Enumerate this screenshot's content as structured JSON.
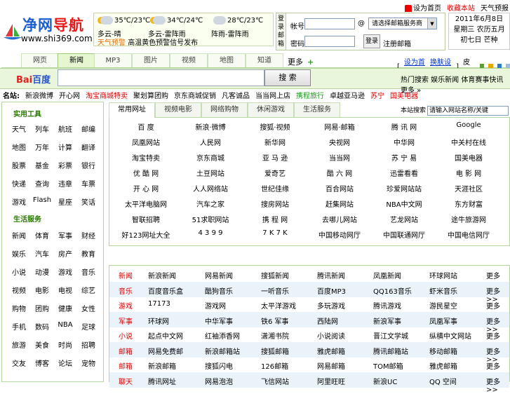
{
  "toplinks": [
    "设为首页",
    "收藏本站",
    "天气预报"
  ],
  "logo": {
    "brand_a": "净网",
    "brand_b": "导航",
    "url": "www.shi369.com"
  },
  "weather": {
    "days": [
      {
        "temp": "35℃/23℃",
        "cond": "多云-晴"
      },
      {
        "temp": "34℃/24℃",
        "cond": "多云-雷阵雨"
      },
      {
        "temp": "28℃/23℃",
        "cond": "阵雨-雷阵雨"
      }
    ],
    "alert_label": "天气预警",
    "alert_text": "高温黄色预警信号发布"
  },
  "mail": {
    "side_label": [
      "登",
      "录",
      "邮",
      "箱"
    ],
    "user_label": "帐号:",
    "pass_label": "密码:",
    "at": "@",
    "select_value": "请选择邮箱服务商",
    "login_button": "登录",
    "register": "注册邮箱"
  },
  "date": {
    "line1": "2011年6月8日",
    "line2": "星期三 农历五月",
    "line3": "初七日 芒种"
  },
  "navtabs": [
    "网页",
    "新闻",
    "MP3",
    "图片",
    "视频",
    "地图",
    "知道"
  ],
  "more_label": "更多",
  "more_plus": "+",
  "colorbar": {
    "link1": "设为首页",
    "link2": "换肤设置",
    "label": "皮肤:",
    "colors": [
      "#5aa02c",
      "#e6a800",
      "#2a7bd0",
      "#9bbde0"
    ]
  },
  "search": {
    "baidu_a": "Bai",
    "baidu_b": "百度",
    "button": "搜 索",
    "hot": "热门搜索 娱乐新闻 体育赛事快讯 更多 »"
  },
  "linkrow": {
    "label": "名站:",
    "items": [
      {
        "t": "新浪微博",
        "c": ""
      },
      {
        "t": "开心网",
        "c": ""
      },
      {
        "t": "淘宝商城特卖",
        "c": "r"
      },
      {
        "t": "聚划算团购",
        "c": ""
      },
      {
        "t": "京东商城促销",
        "c": ""
      },
      {
        "t": "凡客诚品",
        "c": ""
      },
      {
        "t": "当当网上店",
        "c": ""
      },
      {
        "t": "携程旅行",
        "c": "g"
      },
      {
        "t": "卓越亚马逊",
        "c": ""
      },
      {
        "t": "苏宁",
        "c": "r"
      },
      {
        "t": "国美电器",
        "c": "r"
      }
    ]
  },
  "left": {
    "sec1": "实用工具",
    "grid1": [
      [
        "天气",
        "列车",
        "航班",
        "邮编"
      ],
      [
        "地图",
        "万年",
        "计算",
        "翻译"
      ],
      [
        "股票",
        "基金",
        "彩票",
        "银行"
      ],
      [
        "快递",
        "查询",
        "违章",
        "车票"
      ],
      [
        "游戏",
        "Flash",
        "星座",
        "笑话"
      ]
    ],
    "sec2": "生活服务",
    "grid2": [
      [
        "新闻",
        "体育",
        "军事",
        "财经"
      ],
      [
        "娱乐",
        "汽车",
        "房产",
        "教育"
      ],
      [
        "小说",
        "动漫",
        "游戏",
        "音乐"
      ],
      [
        "视频",
        "电影",
        "电视",
        "综艺"
      ],
      [
        "购物",
        "团购",
        "健康",
        "女性"
      ],
      [
        "手机",
        "数码",
        "NBA",
        "足球"
      ],
      [
        "旅游",
        "美食",
        "时尚",
        "招聘"
      ],
      [
        "交友",
        "博客",
        "论坛",
        "宠物"
      ]
    ]
  },
  "cattabs": [
    "常用网址",
    "视频电影",
    "网络购物",
    "休闲游戏",
    "生活服务"
  ],
  "catsearch": {
    "label": "本站搜索",
    "value": "请输入网站名称/关键"
  },
  "sites": [
    [
      "百 度",
      "新浪·微博",
      "搜狐·视频",
      "网易·邮箱",
      "腾 讯 网",
      "Google"
    ],
    [
      "凤凰网站",
      "人民网",
      "新华网",
      "央视网",
      "中华网",
      "中关村在线"
    ],
    [
      "淘宝特卖",
      "京东商城",
      "亚 马 逊",
      "当当网",
      "苏 宁 易",
      "国美电器"
    ],
    [
      "优 酷 网",
      "土豆网站",
      "爱奇艺",
      "酷 六 网",
      "迅雷看看",
      "电 影 网"
    ],
    [
      "开 心 网",
      "人人网络站",
      "世纪佳缘",
      "百合网站",
      "珍爱网站站",
      "天涯社区"
    ],
    [
      "太平洋电脑网",
      "汽车之家",
      "搜房网站",
      "赶集网站",
      "NBA中文网",
      "东方财富"
    ],
    [
      "智联招聘",
      "51求职网站",
      "携 程 网",
      "去哪儿网站",
      "艺龙网站",
      "途牛旅游网"
    ],
    [
      "好123网址大全",
      "4 3 9 9",
      "7 K 7 K",
      "中国移动网厅",
      "中国联通网厅",
      "中国电信网厅"
    ]
  ],
  "rows": [
    {
      "cat": "新闻",
      "items": [
        "新浪新闻",
        "网易新闻",
        "搜狐新闻",
        "腾讯新闻",
        "凤凰新闻",
        "环球网站"
      ],
      "more": "更多>>"
    },
    {
      "cat": "音乐",
      "items": [
        "百度音乐盒",
        "酷狗音乐",
        "一听音乐",
        "百度MP3",
        "QQ163音乐",
        "虾米音乐"
      ],
      "more": "更多>>"
    },
    {
      "cat": "游戏",
      "items": [
        "17173",
        "游戏网",
        "太平洋游戏",
        "多玩游戏",
        "腾讯游戏",
        "游民星空"
      ],
      "more": "更多>>"
    },
    {
      "cat": "军事",
      "items": [
        "环球网",
        "中华军事",
        "铁6 军事",
        "西陆网",
        "新浪军事",
        "凤凰军事"
      ],
      "more": "更多>>"
    },
    {
      "cat": "小说",
      "items": [
        "起点中文网",
        "红袖添香网",
        "潇湘书院",
        "小说阅读",
        "晋江文学城",
        "纵横中文网站"
      ],
      "more": "更多>>"
    },
    {
      "cat": "邮箱",
      "items": [
        "网易免费邮",
        "新浪邮箱站",
        "搜狐邮箱",
        "雅虎邮箱",
        "腾讯邮箱站",
        "移动邮箱"
      ],
      "more": "更多>>"
    },
    {
      "cat": "邮箱",
      "items": [
        "新浪邮箱",
        "搜狐闪电",
        "126邮箱",
        "网易邮箱",
        "TOM邮箱",
        "雅虎邮箱"
      ],
      "more": "更多>>"
    },
    {
      "cat": "聊天",
      "items": [
        "腾讯网址",
        "网易泡泡",
        "飞信网站",
        "阿里旺旺",
        "新浪UC",
        "QQ 空间"
      ],
      "more": "更多>>"
    }
  ]
}
